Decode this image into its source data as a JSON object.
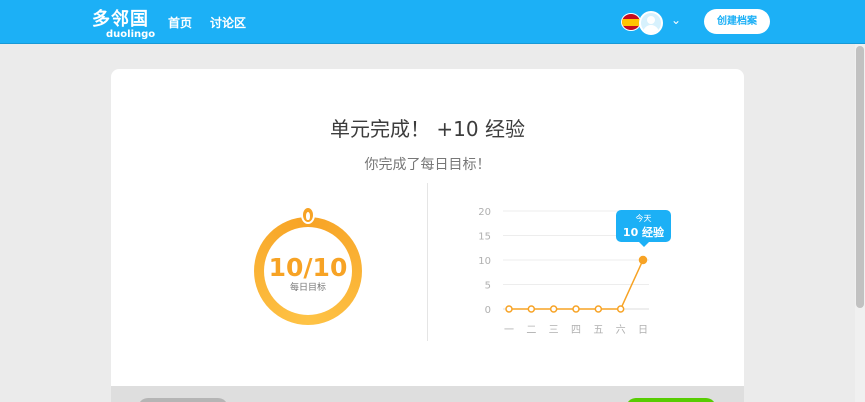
{
  "header": {
    "logo_cn": "多邻国",
    "logo_en": "duolingo",
    "nav": [
      {
        "label": "首页"
      },
      {
        "label": "讨论区"
      }
    ],
    "create_profile_label": "创建档案",
    "dropdown_icon": "chevron-down-icon"
  },
  "card": {
    "title": "单元完成！ +10 经验",
    "subtitle": "你完成了每日目标！",
    "goal": {
      "value_text": "10/10",
      "label": "每日目标",
      "progress": 1.0
    }
  },
  "tooltip": {
    "day": "今天",
    "xp": "10 经验"
  },
  "colors": {
    "brand_blue": "#1cb0f6",
    "goal_orange": "#f7a325",
    "continue_green": "#58cc02"
  },
  "chart_data": {
    "type": "line",
    "categories": [
      "一",
      "二",
      "三",
      "四",
      "五",
      "六",
      "日"
    ],
    "values": [
      0,
      0,
      0,
      0,
      0,
      0,
      10
    ],
    "ylim": [
      0,
      20
    ],
    "yticks": [
      0,
      5,
      10,
      15,
      20
    ],
    "grid": true,
    "color": "#f7a325"
  }
}
